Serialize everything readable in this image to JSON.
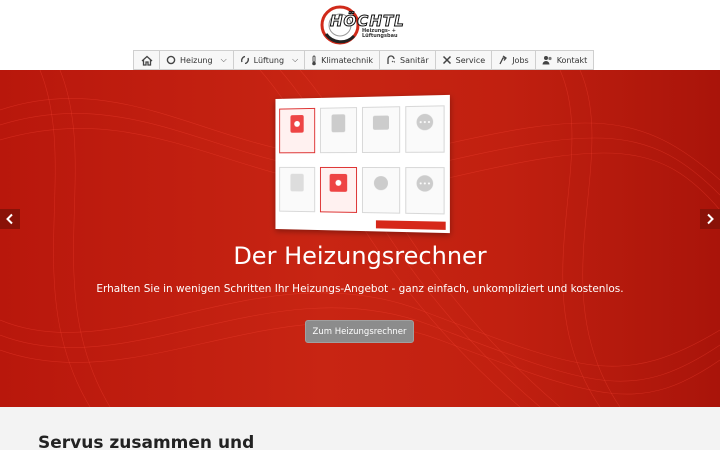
{
  "logo": {
    "wordmark": "HÖCHTL",
    "tagline": "Heizungs- + Lüftungsbau"
  },
  "nav": {
    "items": [
      {
        "label": "",
        "icon": "home-icon"
      },
      {
        "label": "Heizung",
        "icon": "heating-icon",
        "dropdown": true
      },
      {
        "label": "Lüftung",
        "icon": "ventilation-icon",
        "dropdown": true
      },
      {
        "label": "Klimatechnik",
        "icon": "thermometer-icon"
      },
      {
        "label": "Sanitär",
        "icon": "shower-icon"
      },
      {
        "label": "Service",
        "icon": "tools-icon"
      },
      {
        "label": "Jobs",
        "icon": "arrow-icon"
      },
      {
        "label": "Kontakt",
        "icon": "people-icon"
      }
    ]
  },
  "hero": {
    "title": "Der Heizungsrechner",
    "subtitle": "Erhalten Sie in wenigen Schritten Ihr Heizungs-Angebot - ganz einfach, unkompliziert und kostenlos.",
    "button_label": "Zum Heizungsrechner",
    "prev_icon": "chevron-left-icon",
    "next_icon": "chevron-right-icon"
  },
  "section": {
    "title": "Servus zusammen und"
  },
  "colors": {
    "brand_red": "#c82513",
    "button_gray": "#8c8c8c",
    "arrow_bg": "#8a1208"
  }
}
